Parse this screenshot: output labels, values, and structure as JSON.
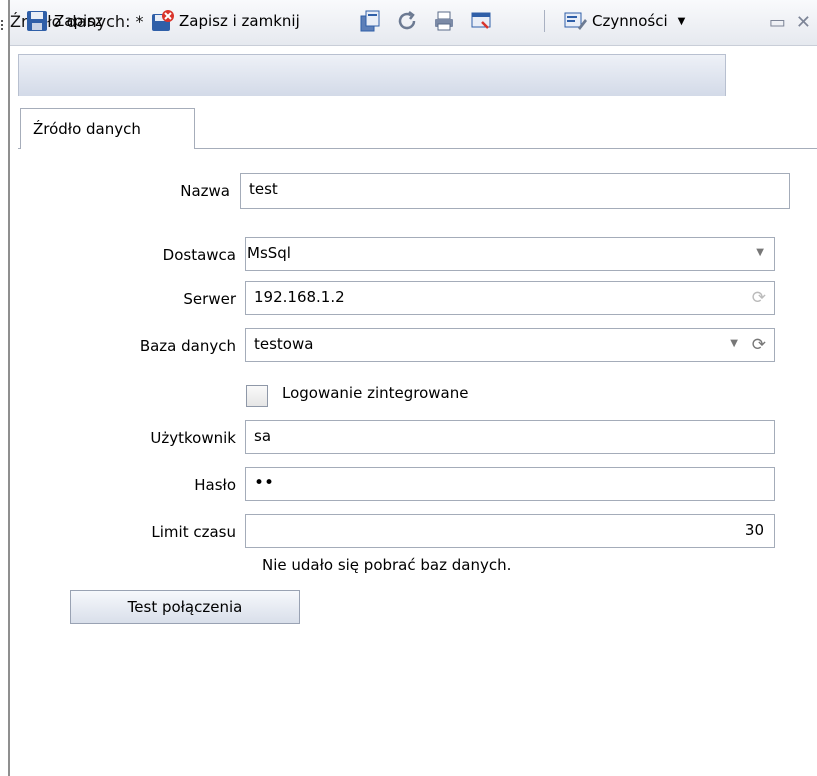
{
  "window": {
    "title": "Źródło danych: *"
  },
  "toolbar": {
    "save_label": "Zapisz",
    "save_close_label": "Zapisz i zamknij",
    "actions_label": "Czynności"
  },
  "tabs": [
    {
      "label": "Źródło danych"
    }
  ],
  "form": {
    "name": {
      "label": "Nazwa",
      "value": "test"
    },
    "provider": {
      "label": "Dostawca",
      "value": "MsSql"
    },
    "server": {
      "label": "Serwer",
      "value": "192.168.1.2"
    },
    "database": {
      "label": "Baza danych",
      "value": "testowa"
    },
    "integrated": {
      "label": "Logowanie zintegrowane",
      "checked": false
    },
    "user": {
      "label": "Użytkownik",
      "value": "sa"
    },
    "password": {
      "label": "Hasło",
      "value": "••"
    },
    "timeout": {
      "label": "Limit czasu",
      "value": "30"
    },
    "error": "Nie udało się pobrać baz danych.",
    "test_button": "Test połączenia"
  },
  "icons": {
    "save": "save-icon",
    "save_close": "save-close-icon",
    "copy": "copy-icon",
    "refresh": "refresh-icon",
    "print": "print-icon",
    "preview": "preview-icon",
    "actions": "actions-icon"
  },
  "colors": {
    "accent": "#2f5fa8",
    "close_red": "#d9342b",
    "frame": "#a4acb9"
  }
}
